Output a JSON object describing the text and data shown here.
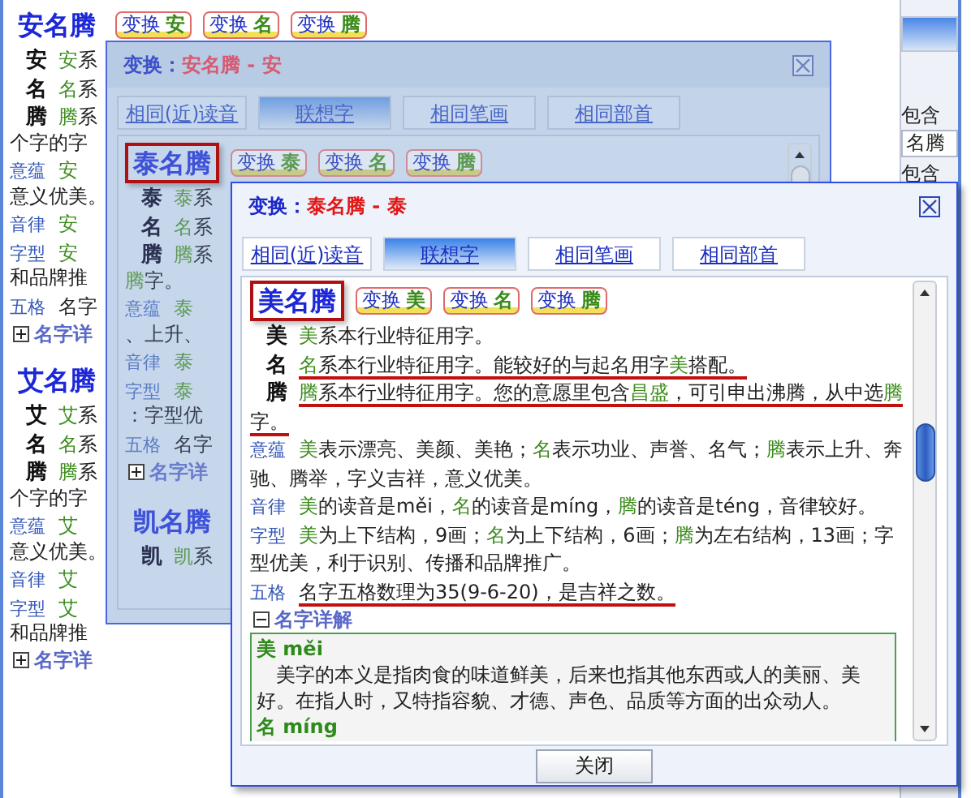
{
  "page": {
    "results": [
      {
        "name": "安名腾",
        "boxed": false,
        "swaps": [
          {
            "label": "变换",
            "char": "安"
          },
          {
            "label": "变换",
            "char": "名"
          },
          {
            "label": "变换",
            "char": "腾"
          }
        ],
        "lines": [
          {
            "kind": "char",
            "label": "安",
            "text": "**安**系"
          },
          {
            "kind": "char",
            "label": "名",
            "text": "**名**系"
          },
          {
            "kind": "char",
            "label": "腾",
            "text": "**腾**系"
          },
          {
            "kind": "text",
            "text": "个字的字"
          },
          {
            "kind": "aspect",
            "label": "意蕴",
            "text": "**安**"
          },
          {
            "kind": "text",
            "text": "意义优美。"
          },
          {
            "kind": "aspect",
            "label": "音律",
            "text": "**安**"
          },
          {
            "kind": "aspect",
            "label": "字型",
            "text": "**安**"
          },
          {
            "kind": "text",
            "text": "和品牌推"
          },
          {
            "kind": "aspect",
            "label": "五格",
            "text": "名字"
          },
          {
            "kind": "toggle",
            "label": "名字详",
            "expanded": false
          }
        ]
      },
      {
        "name": "艾名腾",
        "boxed": false,
        "lines": [
          {
            "kind": "char",
            "label": "艾",
            "text": "**艾**系"
          },
          {
            "kind": "char",
            "label": "名",
            "text": "**名**系"
          },
          {
            "kind": "char",
            "label": "腾",
            "text": "**腾**系"
          },
          {
            "kind": "text",
            "text": "个字的字"
          },
          {
            "kind": "aspect",
            "label": "意蕴",
            "text": "**艾**"
          },
          {
            "kind": "text",
            "text": "意义优美。"
          },
          {
            "kind": "aspect",
            "label": "音律",
            "text": "**艾**"
          },
          {
            "kind": "aspect",
            "label": "字型",
            "text": "**艾**"
          },
          {
            "kind": "text",
            "text": "和品牌推"
          },
          {
            "kind": "toggle",
            "label": "名字详",
            "expanded": false
          }
        ]
      }
    ],
    "side_panel": {
      "label": "包含",
      "field_value": "名腾",
      "label_2": "包含"
    }
  },
  "back_dialog": {
    "title_prefix": "变换：",
    "title_name": "安名腾 - 安",
    "tabs": [
      {
        "label": "相同(近)读音",
        "selected": false
      },
      {
        "label": "联想字",
        "selected": true
      },
      {
        "label": "相同笔画",
        "selected": false
      },
      {
        "label": "相同部首",
        "selected": false
      }
    ],
    "results": [
      {
        "name": "泰名腾",
        "boxed": true,
        "swaps": [
          {
            "label": "变换",
            "char": "泰"
          },
          {
            "label": "变换",
            "char": "名"
          },
          {
            "label": "变换",
            "char": "腾"
          }
        ],
        "lines": [
          {
            "kind": "char",
            "label": "泰",
            "text": "**泰**系"
          },
          {
            "kind": "char",
            "label": "名",
            "text": "**名**系"
          },
          {
            "kind": "char",
            "label": "腾",
            "text": "**腾**系"
          },
          {
            "kind": "text",
            "text": "**腾**字。"
          },
          {
            "kind": "aspect",
            "label": "意蕴",
            "text": "**泰**"
          },
          {
            "kind": "text",
            "text": "、上升、"
          },
          {
            "kind": "aspect",
            "label": "音律",
            "text": "**泰**"
          },
          {
            "kind": "aspect",
            "label": "字型",
            "text": "**泰**"
          },
          {
            "kind": "text",
            "text": "：字型优"
          },
          {
            "kind": "aspect",
            "label": "五格",
            "text": "名字"
          },
          {
            "kind": "toggle",
            "label": "名字详",
            "expanded": false
          }
        ]
      },
      {
        "name": "凯名腾",
        "boxed": false,
        "lines": [
          {
            "kind": "char",
            "label": "凯",
            "text": "**凯**系"
          }
        ]
      }
    ]
  },
  "dialog": {
    "title_prefix": "变换：",
    "title_name": "泰名腾 - 泰",
    "tabs": [
      {
        "label": "相同(近)读音",
        "selected": false
      },
      {
        "label": "联想字",
        "selected": true
      },
      {
        "label": "相同笔画",
        "selected": false
      },
      {
        "label": "相同部首",
        "selected": false
      }
    ],
    "results": [
      {
        "name": "美名腾",
        "boxed": true,
        "swaps": [
          {
            "label": "变换",
            "char": "美"
          },
          {
            "label": "变换",
            "char": "名"
          },
          {
            "label": "变换",
            "char": "腾"
          }
        ],
        "lines": [
          {
            "kind": "char",
            "label": "美",
            "underlined": false,
            "text": "**美**系本行业特征用字。"
          },
          {
            "kind": "char",
            "label": "名",
            "underlined": true,
            "text": "**名**系本行业特征用字。能较好的与起名用字**美**搭配。"
          },
          {
            "kind": "char",
            "label": "腾",
            "underlined": true,
            "text": "**腾**系本行业特征用字。您的意愿里包含**昌盛**，可引申出沸腾，从中选**腾**字。"
          },
          {
            "kind": "aspect",
            "label": "意蕴",
            "underlined": false,
            "text": "**美**表示漂亮、美颜、美艳；**名**表示功业、声誉、名气；**腾**表示上升、奔驰、腾举，字义吉祥，意义优美。"
          },
          {
            "kind": "aspect",
            "label": "音律",
            "underlined": false,
            "text": "**美**的读音是měi，**名**的读音是míng，**腾**的读音是téng，音律较好。"
          },
          {
            "kind": "aspect",
            "label": "字型",
            "underlined": false,
            "text": "**美**为上下结构，9画；**名**为上下结构，6画；**腾**为左右结构，13画；字型优美，利于识别、传播和品牌推广。"
          },
          {
            "kind": "aspect",
            "label": "五格",
            "underlined": true,
            "text": "名字五格数理为35(9-6-20)，是吉祥之数。"
          },
          {
            "kind": "toggle",
            "label": "名字详解",
            "expanded": true
          }
        ]
      }
    ],
    "details": [
      {
        "heading": "美 měi",
        "text": "美字的本义是指肉食的味道鲜美，后来也指其他东西或人的美丽、美好。在指人时，又特指容貌、才德、声色、品质等方面的出众动人。"
      },
      {
        "heading": "名 míng"
      }
    ],
    "close_button": "关闭"
  }
}
